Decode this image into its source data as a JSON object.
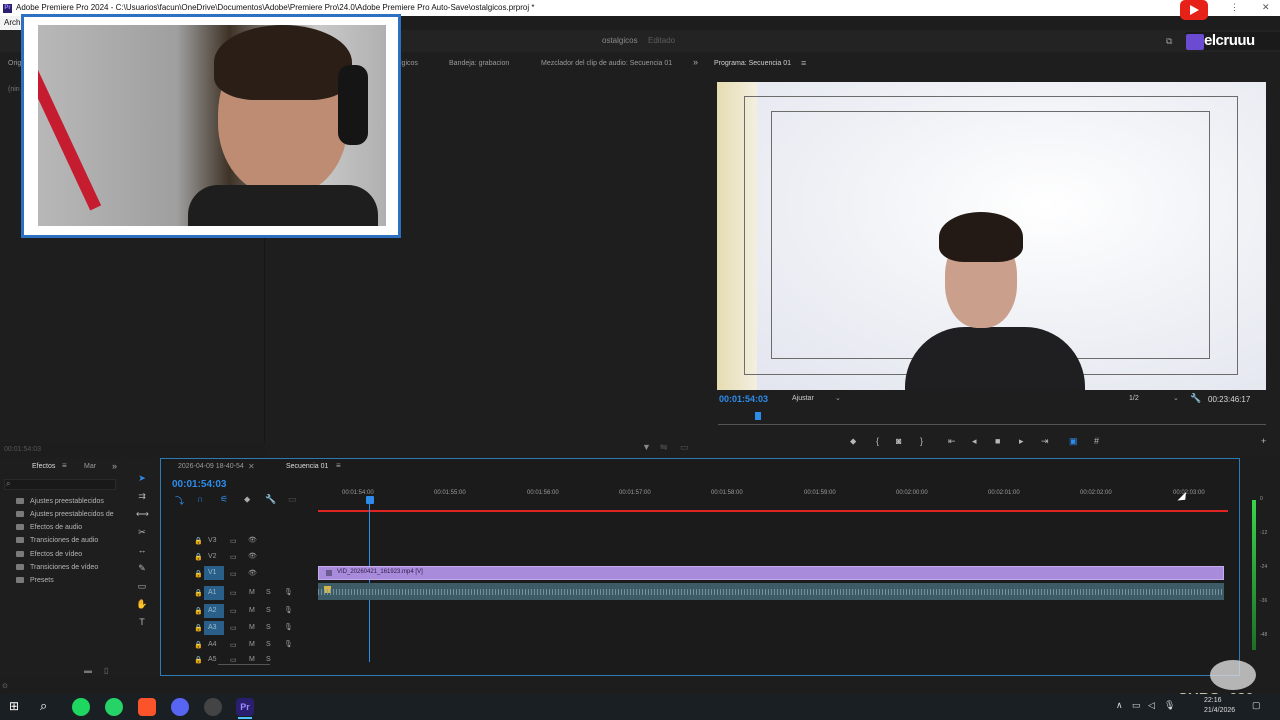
{
  "window": {
    "title": "Adobe Premiere Pro 2024 - C:\\Usuarios\\facun\\OneDrive\\Documentos\\Adobe\\Premiere Pro\\24.0\\Adobe Premiere Pro Auto-Save\\ostalgicos.prproj *",
    "menu_first": "Arch",
    "project_name": "ostalgicos",
    "project_state": "Editado"
  },
  "panels": {
    "left_tab_partial": "Orig",
    "left_sub_partial": "(nin",
    "tab_partial": "lgicos",
    "bandeja": "Bandeja: grabacion",
    "mezclador": "Mezclador del clip de audio: Secuencia 01",
    "program": "Programa: Secuencia 01",
    "source_tc": "00:01:54:03"
  },
  "program_monitor": {
    "timecode": "00:01:54:03",
    "fit": "Ajustar",
    "resolution": "1/2",
    "duration": "00:23:46:17"
  },
  "effects": {
    "tab": "Efectos",
    "tab2": "Mar",
    "items": [
      "Ajustes preestablecidos",
      "Ajustes preestablecidos de",
      "Efectos de audio",
      "Transiciones de audio",
      "Efectos de vídeo",
      "Transiciones de vídeo",
      "Presets"
    ]
  },
  "timeline": {
    "tab1": "2026-04-09 18-40-54",
    "tab2": "Secuencia 01",
    "timecode": "00:01:54:03",
    "ticks": [
      "00:01:54:00",
      "00:01:55:00",
      "00:01:56:00",
      "00:01:57:00",
      "00:01:58:00",
      "00:01:59:00",
      "00:02:00:00",
      "00:02:01:00",
      "00:02:02:00",
      "00:02:03:00"
    ],
    "video_tracks": [
      "V3",
      "V2",
      "V1"
    ],
    "audio_tracks": [
      "A1",
      "A2",
      "A3",
      "A4",
      "A5"
    ],
    "clip_name": "VID_20260421_161923.mp4 [V]",
    "mute": "M",
    "solo": "S"
  },
  "meter_labels": [
    "0",
    "-12",
    "-24",
    "-36",
    "-48"
  ],
  "overlay": {
    "brand": "elcruuu",
    "subs": "SUBS: 630"
  },
  "taskbar": {
    "time": "22:16",
    "date": "21/4/2026"
  },
  "colors": {
    "accent_blue": "#2d8ceb",
    "clip_purple": "#a98bdc",
    "audio_teal": "#3d5a67",
    "playhead_red": "#e02424"
  }
}
